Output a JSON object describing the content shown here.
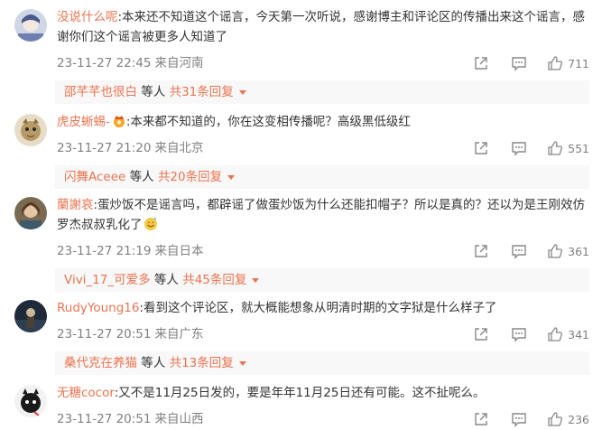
{
  "comments": [
    {
      "username": "没说什么呢",
      "text": ":本来还不知道这个谣言，今天第一次听说，感谢博主和评论区的传播出来这个谣言，感谢你们这个谣言被更多人知道了",
      "time": "23-11-27 22:45",
      "location": "来自河南",
      "likes": "711",
      "reply_user": "邵芊芊也很白",
      "reply_etc": "等人",
      "reply_total": "共31条回复"
    },
    {
      "username": "虎皮蜥蜴-",
      "text": ":本来都不知道的，你在这变相传播呢？高级黑低级红",
      "time": "23-11-27 21:20",
      "location": "来自北京",
      "likes": "551",
      "reply_user": "闪舞Aceee",
      "reply_etc": "等人",
      "reply_total": "共20条回复"
    },
    {
      "username": "蘭謝哀",
      "text": ":蛋炒饭不是谣言吗，都辟谣了做蛋炒饭为什么还能扣帽子？所以是真的？还以为是王刚效仿罗杰叔叔乳化了",
      "time": "23-11-27 21:19",
      "location": "来自日本",
      "likes": "361",
      "reply_user": "Vivi_17_可爱多",
      "reply_etc": "等人",
      "reply_total": "共45条回复"
    },
    {
      "username": "RudyYoung16",
      "text": ":看到这个评论区，就大概能想象从明清时期的文字狱是什么样子了",
      "time": "23-11-27 20:51",
      "location": "来自广东",
      "likes": "341",
      "reply_user": "桑代克在养猫",
      "reply_etc": "等人",
      "reply_total": "共13条回复"
    },
    {
      "username": "无糖cocor",
      "text": ":又不是11月25日发的，要是年年11月25日还有可能。这不扯呢么。",
      "time": "23-11-27 20:51",
      "location": "来自山西",
      "likes": "236"
    }
  ],
  "colors": {
    "username": "#eb7350",
    "meta": "#808080",
    "reply_bg": "#f8f8f8"
  },
  "icons": [
    "repost-icon",
    "comment-icon",
    "like-icon",
    "crown-badge-icon",
    "sweat-smile-emoji"
  ]
}
